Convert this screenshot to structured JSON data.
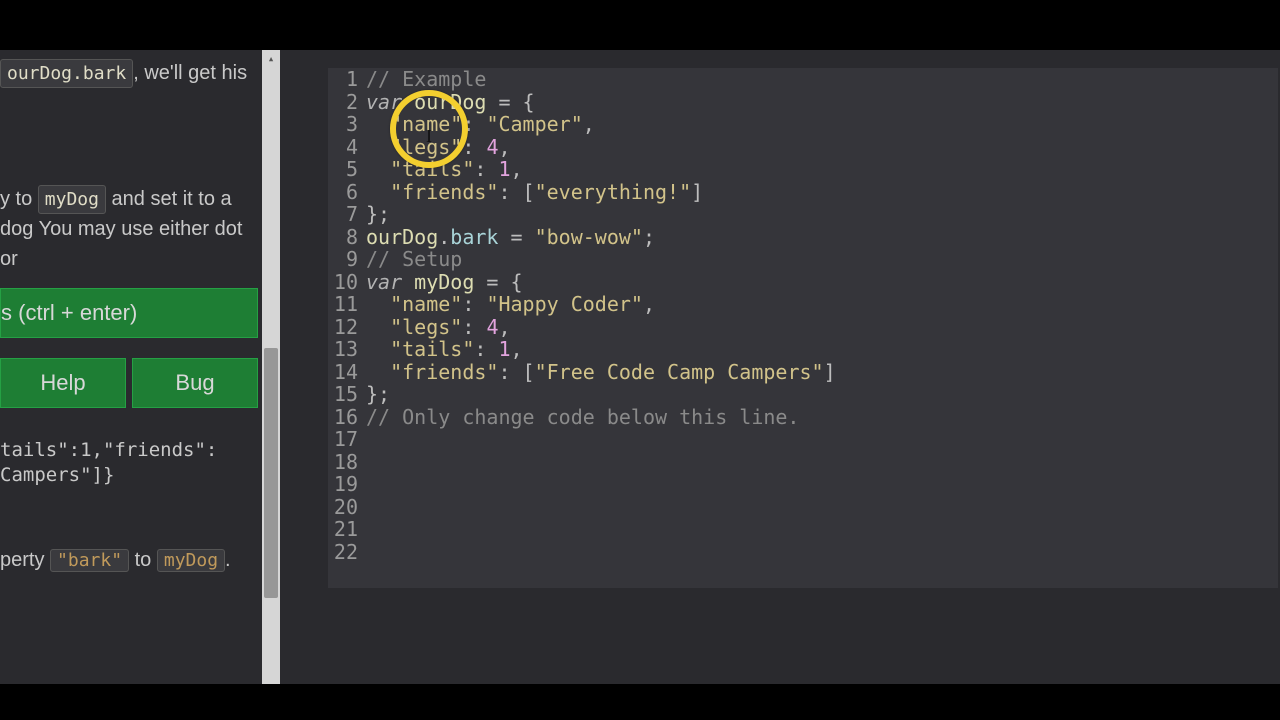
{
  "left": {
    "tag1": "ourDog.bark",
    "text1_after": ", we'll get his",
    "text2_before": "y to ",
    "tag2": "myDog",
    "text2_after": " and set it to a dog You may use either dot or",
    "run_btn": "s (ctrl + enter)",
    "help_btn": "Help",
    "bug_btn": "Bug",
    "output_l1": "tails\":1,\"friends\":",
    "output_l2": "Campers\"]}",
    "task_before": "perty ",
    "task_tag1": "\"bark\"",
    "task_mid": " to ",
    "task_tag2": "myDog",
    "task_after": "."
  },
  "code": {
    "lines": [
      {
        "n": 1,
        "raw": ""
      },
      {
        "n": 2,
        "comment": "// Example"
      },
      {
        "n": 3,
        "kw": "var",
        "ident": "ourDog",
        "rest": " = {"
      },
      {
        "n": 4,
        "indent": "  ",
        "key": "\"name\"",
        "colon": ": ",
        "str": "\"Camper\"",
        "comma": ","
      },
      {
        "n": 5,
        "indent": "  ",
        "key": "\"legs\"",
        "colon": ": ",
        "num": "4",
        "comma": ","
      },
      {
        "n": 6,
        "indent": "  ",
        "key": "\"tails\"",
        "colon": ": ",
        "num": "1",
        "comma": ","
      },
      {
        "n": 7,
        "indent": "  ",
        "key": "\"friends\"",
        "colon": ": [",
        "str": "\"everything!\"",
        "close": "]"
      },
      {
        "n": 8,
        "raw": "};"
      },
      {
        "n": 9,
        "raw": ""
      },
      {
        "n": 10,
        "ident": "ourDog",
        "dot": ".",
        "prop": "bark",
        "rest2": " = ",
        "str": "\"bow-wow\"",
        "semi": ";"
      },
      {
        "n": 11,
        "raw": ""
      },
      {
        "n": 12,
        "comment": "// Setup"
      },
      {
        "n": 13,
        "kw": "var",
        "ident": "myDog",
        "rest": " = {"
      },
      {
        "n": 14,
        "indent": "  ",
        "key": "\"name\"",
        "colon": ": ",
        "str": "\"Happy Coder\"",
        "comma": ","
      },
      {
        "n": 15,
        "indent": "  ",
        "key": "\"legs\"",
        "colon": ": ",
        "num": "4",
        "comma": ","
      },
      {
        "n": 16,
        "indent": "  ",
        "key": "\"tails\"",
        "colon": ": ",
        "num": "1",
        "comma": ","
      },
      {
        "n": 17,
        "indent": "  ",
        "key": "\"friends\"",
        "colon": ": [",
        "str": "\"Free Code Camp Campers\"",
        "close": "]"
      },
      {
        "n": 18,
        "raw": "};"
      },
      {
        "n": 19,
        "raw": ""
      },
      {
        "n": 20,
        "comment": "// Only change code below this line."
      },
      {
        "n": 21,
        "raw": ""
      },
      {
        "n": 22,
        "raw": ""
      }
    ]
  },
  "annotation": {
    "highlight_target": "ourDog"
  }
}
